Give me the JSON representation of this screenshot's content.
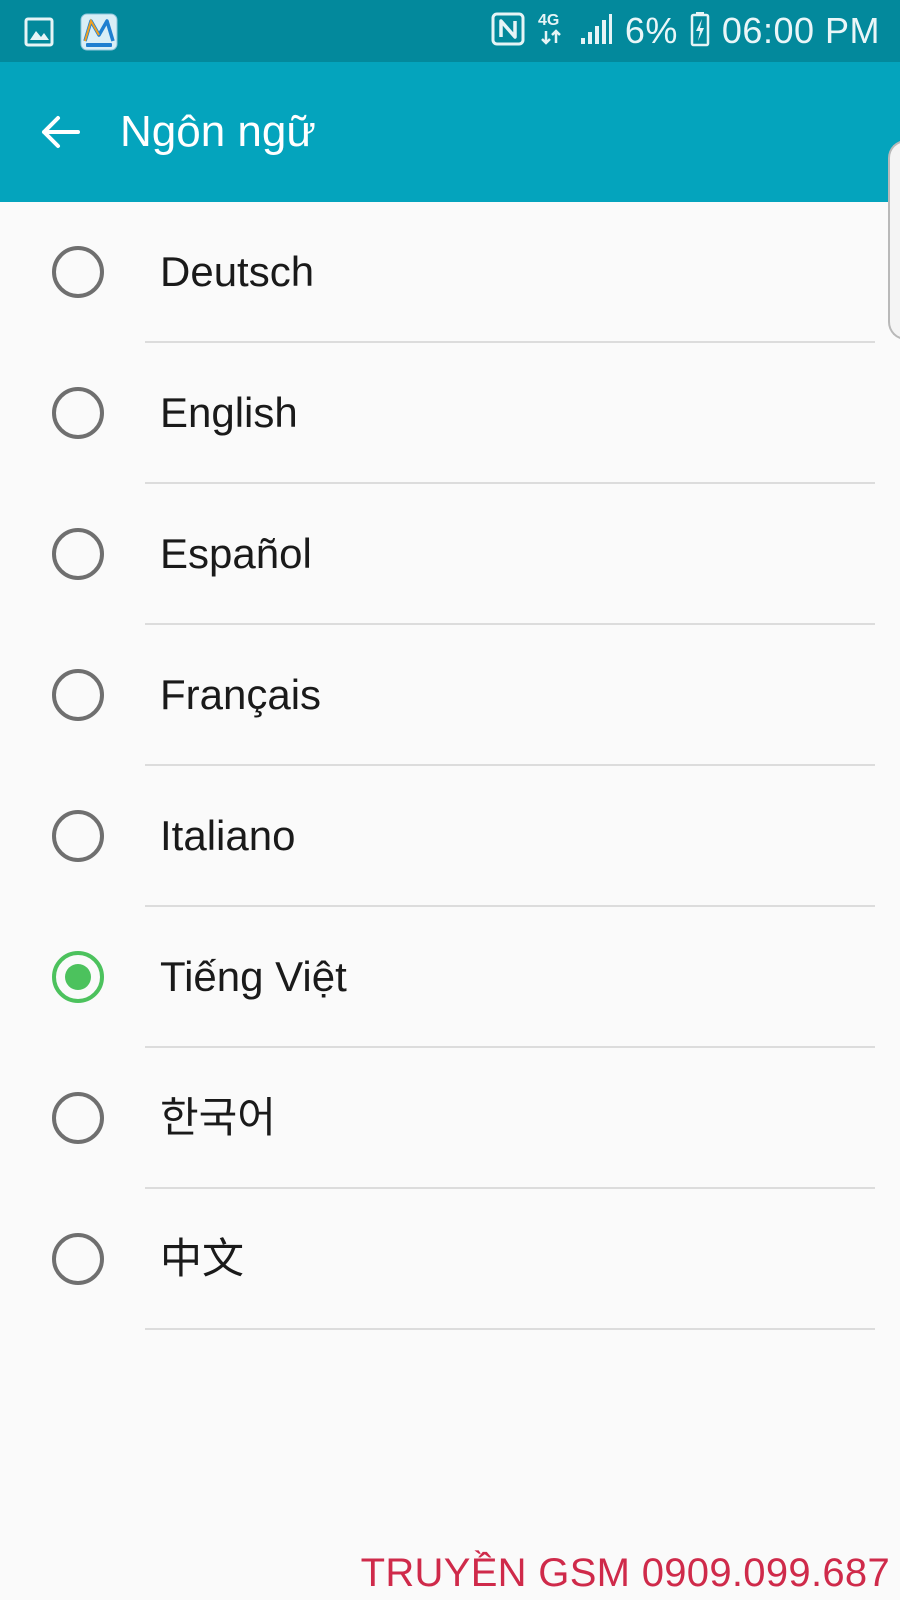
{
  "status_bar": {
    "battery_percent": "6%",
    "network": "4G",
    "time": "06:00 PM",
    "left_icons": [
      "gallery-notification-icon",
      "app-notification-icon"
    ],
    "right_icons": [
      "nfc-icon",
      "4g-data-icon",
      "signal-icon",
      "battery-charging-icon"
    ]
  },
  "app_bar": {
    "title": "Ngôn ngữ",
    "back_icon": "arrow-left-icon"
  },
  "languages": [
    {
      "label": "Deutsch",
      "selected": false
    },
    {
      "label": "English",
      "selected": false
    },
    {
      "label": "Español",
      "selected": false
    },
    {
      "label": "Français",
      "selected": false
    },
    {
      "label": "Italiano",
      "selected": false
    },
    {
      "label": "Tiếng Việt",
      "selected": true
    },
    {
      "label": "한국어",
      "selected": false
    },
    {
      "label": "中文",
      "selected": false
    }
  ],
  "watermark": "TRUYỀN GSM 0909.099.687",
  "colors": {
    "status_bar": "#03899c",
    "app_bar": "#04a4bd",
    "radio_selected": "#4cc25d",
    "radio_unselected": "#6f6f6f",
    "watermark": "#cf2a4a"
  }
}
